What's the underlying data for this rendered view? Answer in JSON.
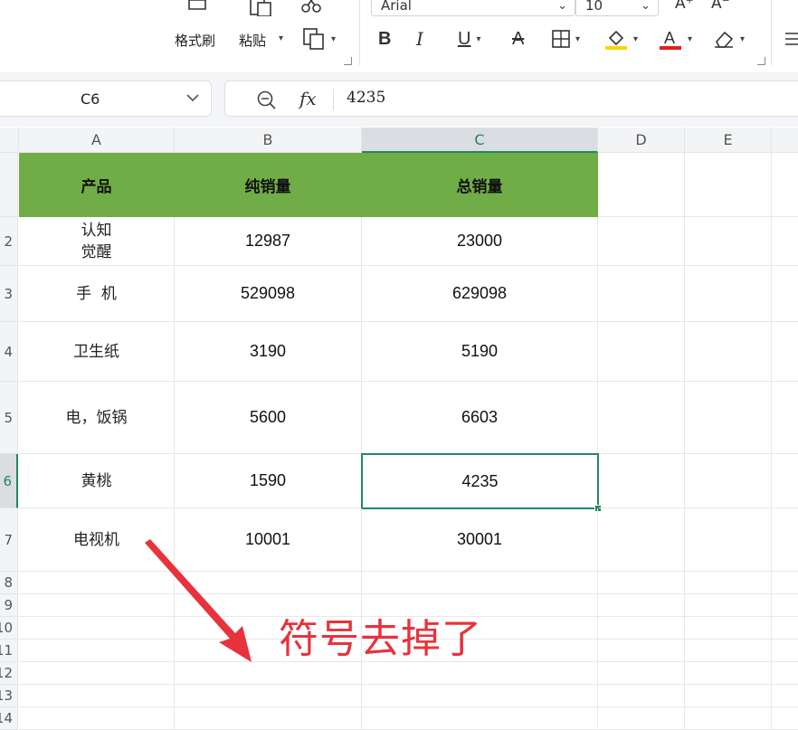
{
  "ribbon": {
    "format_painter": "格式刷",
    "paste": "粘贴",
    "font_name": "Arial",
    "font_size": "10",
    "grow_font": "A⁺",
    "shrink_font": "A⁻",
    "bold": "B",
    "italic": "I",
    "underline": "U",
    "strike": "A",
    "font_color_letter": "A",
    "fill_color": "#ffd400",
    "font_color": "#e02020"
  },
  "formula_bar": {
    "cell_ref": "C6",
    "fx": "fx",
    "value": "4235"
  },
  "grid": {
    "columns": [
      "A",
      "B",
      "C",
      "D",
      "E"
    ],
    "active_column": "C",
    "active_row": "6",
    "row_numbers": [
      "2",
      "3",
      "4",
      "5",
      "6",
      "7",
      "8",
      "9",
      "10",
      "11",
      "12",
      "13",
      "14"
    ],
    "header": [
      "产品",
      "纯销量",
      "总销量"
    ],
    "rows": [
      {
        "product": "认知\n觉醒",
        "net": "12987",
        "total": "23000"
      },
      {
        "product": "手  机",
        "net": "529098",
        "total": "629098"
      },
      {
        "product": "卫生纸",
        "net": "3190",
        "total": "5190"
      },
      {
        "product": "电，饭锅",
        "net": "5600",
        "total": "6603"
      },
      {
        "product": "黄桃",
        "net": "1590",
        "total": "4235"
      },
      {
        "product": "电视机",
        "net": "10001",
        "total": "30001"
      }
    ],
    "header_fill": "#70ad47",
    "selection_color": "#1f8a5b"
  },
  "annotation": {
    "text": "符号去掉了",
    "color": "#e8323c"
  }
}
